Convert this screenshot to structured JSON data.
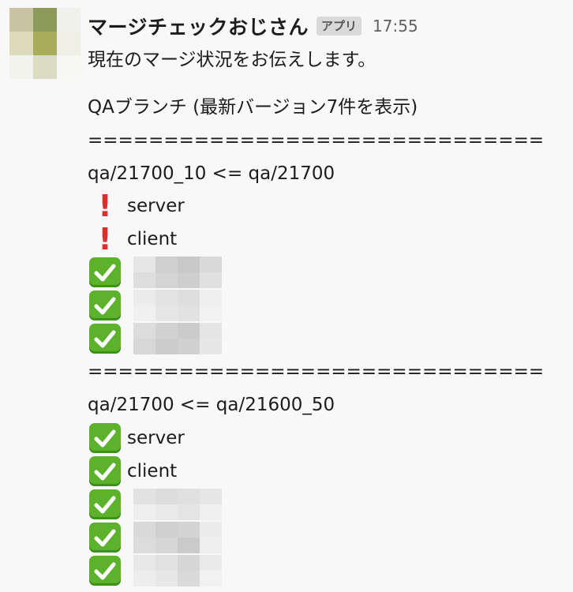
{
  "message": {
    "sender": "マージチェックおじさん",
    "badge": "アプリ",
    "time": "17:55",
    "intro": "現在のマージ状況をお伝えします。",
    "heading": "QAブランチ (最新バージョン7件を表示)",
    "separator": "==============================",
    "sections": [
      {
        "title": "qa/21700_10 <= qa/21700",
        "items": [
          {
            "status": "error-icon",
            "label": "server"
          },
          {
            "status": "error-icon",
            "label": "client"
          },
          {
            "status": "check-icon",
            "label": ""
          },
          {
            "status": "check-icon",
            "label": ""
          },
          {
            "status": "check-icon",
            "label": ""
          }
        ]
      },
      {
        "title": "qa/21700 <= qa/21600_50",
        "items": [
          {
            "status": "check-icon",
            "label": "server"
          },
          {
            "status": "check-icon",
            "label": "client"
          },
          {
            "status": "check-icon",
            "label": ""
          },
          {
            "status": "check-icon",
            "label": ""
          },
          {
            "status": "check-icon",
            "label": ""
          }
        ]
      }
    ]
  },
  "colors": {
    "background": "#f8f8f8",
    "error": "#dd2e2e",
    "check": "#5cb32b",
    "badge_bg": "#d9d9d9"
  }
}
